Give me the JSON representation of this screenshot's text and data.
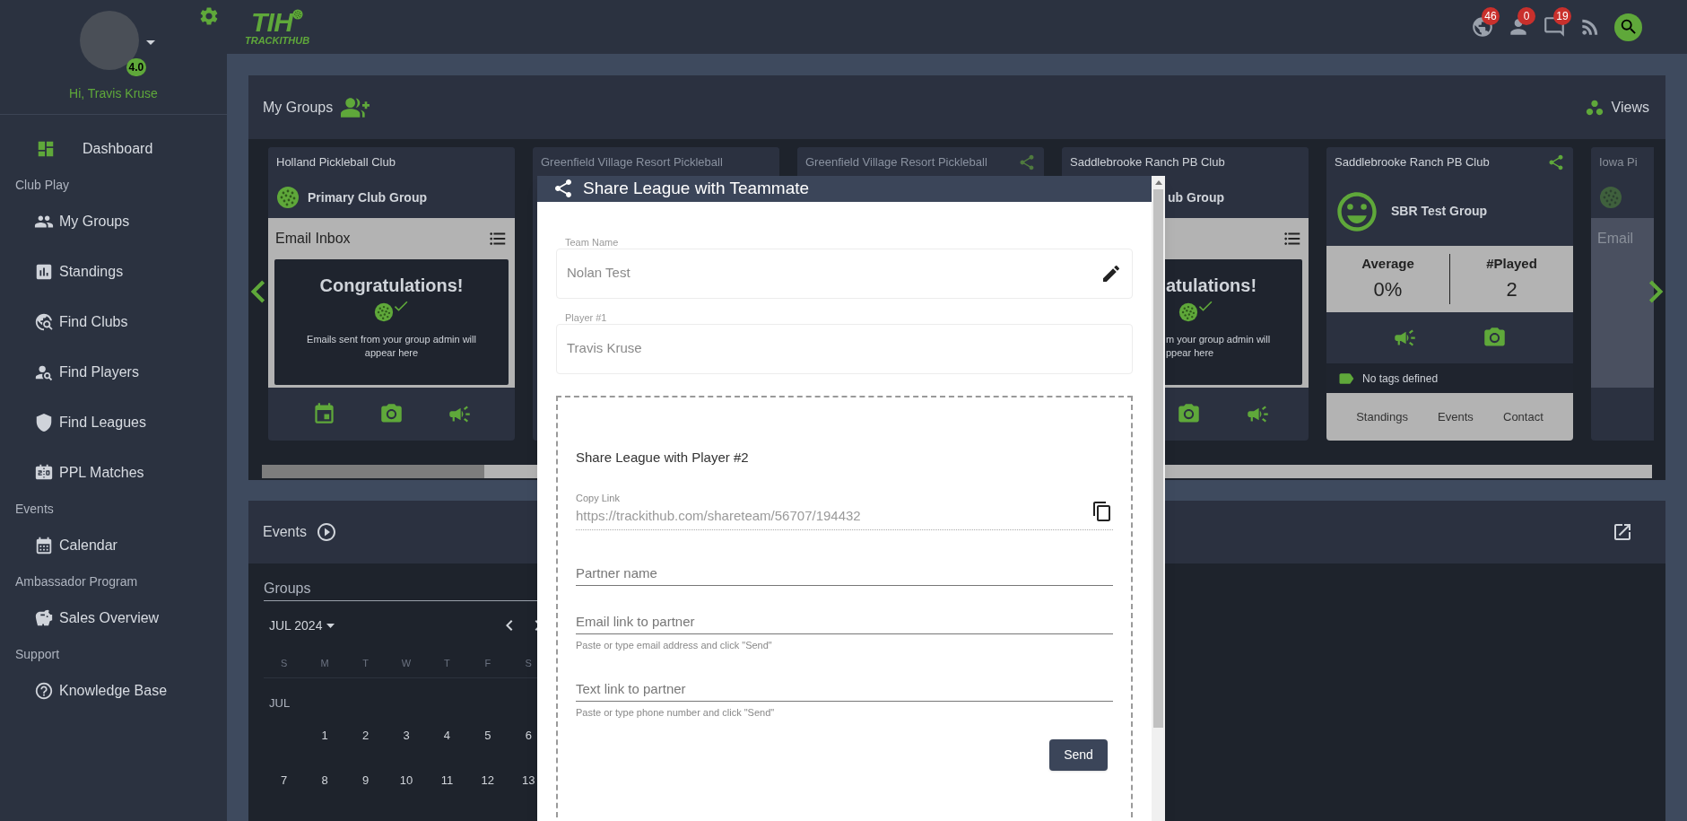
{
  "header": {
    "logo_mark": "TIH",
    "logo_text": "TRACKITHUB",
    "notifications": [
      {
        "kind": "globe",
        "count": "46"
      },
      {
        "kind": "person",
        "count": "0"
      },
      {
        "kind": "chat",
        "count": "19"
      },
      {
        "kind": "feed"
      }
    ]
  },
  "sidebar": {
    "rating": "4.0",
    "greeting": "Hi, Travis Kruse",
    "items": [
      {
        "kind": "link",
        "label": "Dashboard"
      },
      {
        "kind": "heading",
        "label": "Club Play"
      },
      {
        "kind": "link",
        "label": "My Groups"
      },
      {
        "kind": "link",
        "label": "Standings"
      },
      {
        "kind": "link",
        "label": "Find Clubs"
      },
      {
        "kind": "link",
        "label": "Find Players"
      },
      {
        "kind": "link",
        "label": "Find Leagues"
      },
      {
        "kind": "link",
        "label": "PPL Matches"
      },
      {
        "kind": "heading",
        "label": "Events"
      },
      {
        "kind": "link",
        "label": "Calendar"
      },
      {
        "kind": "heading",
        "label": "Ambassador Program"
      },
      {
        "kind": "link",
        "label": "Sales Overview"
      },
      {
        "kind": "heading",
        "label": "Support"
      },
      {
        "kind": "link",
        "label": "Knowledge Base"
      }
    ]
  },
  "my_groups": {
    "title": "My Groups",
    "views_label": "Views",
    "cards": [
      {
        "kind": "inbox",
        "title": "Holland Pickleball Club",
        "group": "Primary Club Group",
        "inbox": "Email Inbox",
        "congrats": "Congratulations!",
        "message": "Emails sent from your group admin will appear here"
      },
      {
        "kind": "hidden",
        "title": "Greenfield Village Resort Pickleball"
      },
      {
        "kind": "hidden",
        "title": "Greenfield Village Resort Pickleball",
        "shared": true
      },
      {
        "kind": "partial",
        "title": "Saddlebrooke Ranch PB Club",
        "group": "ub Group",
        "congrats": "atulations!",
        "message_lines": [
          "m your group admin will",
          "ppear here"
        ]
      },
      {
        "kind": "stats",
        "title": "Saddlebrooke Ranch PB Club",
        "shared": true,
        "group": "SBR Test Group",
        "stats": [
          {
            "label": "Average",
            "value": "0%"
          },
          {
            "label": "#Played",
            "value": "2"
          }
        ],
        "tags": "No tags defined",
        "links": [
          "Standings",
          "Events",
          "Contact"
        ]
      },
      {
        "kind": "cut",
        "title": "Iowa Pi",
        "inbox": "Email"
      }
    ]
  },
  "events": {
    "title": "Events",
    "filter_label": "Groups",
    "month": "JUL 2024",
    "weekdays": [
      "S",
      "M",
      "T",
      "W",
      "T",
      "F",
      "S"
    ],
    "month_label": "JUL",
    "weeks": [
      {
        "kind": "partial",
        "days": [
          "1",
          "2",
          "3",
          "4",
          "5",
          "6"
        ]
      },
      {
        "kind": "full",
        "days": [
          "7",
          "8",
          "9",
          "10",
          "11",
          "12",
          "13"
        ]
      }
    ]
  },
  "modal": {
    "title": "Share League with Teammate",
    "fields": [
      {
        "label": "Team Name",
        "value": "Nolan Test",
        "editable": true
      },
      {
        "label": "Player #1",
        "value": "Travis Kruse",
        "editable": false
      }
    ],
    "share": {
      "heading": "Share League with Player #2",
      "copy_label": "Copy Link",
      "link": "https://trackithub.com/shareteam/56707/194432",
      "inputs": [
        {
          "placeholder": "Partner name"
        },
        {
          "placeholder": "Email link to partner",
          "hint": "Paste or type email address and click \"Send\""
        },
        {
          "placeholder": "Text link to partner",
          "hint": "Paste or type phone number and click \"Send\""
        }
      ],
      "button": "Send"
    }
  }
}
